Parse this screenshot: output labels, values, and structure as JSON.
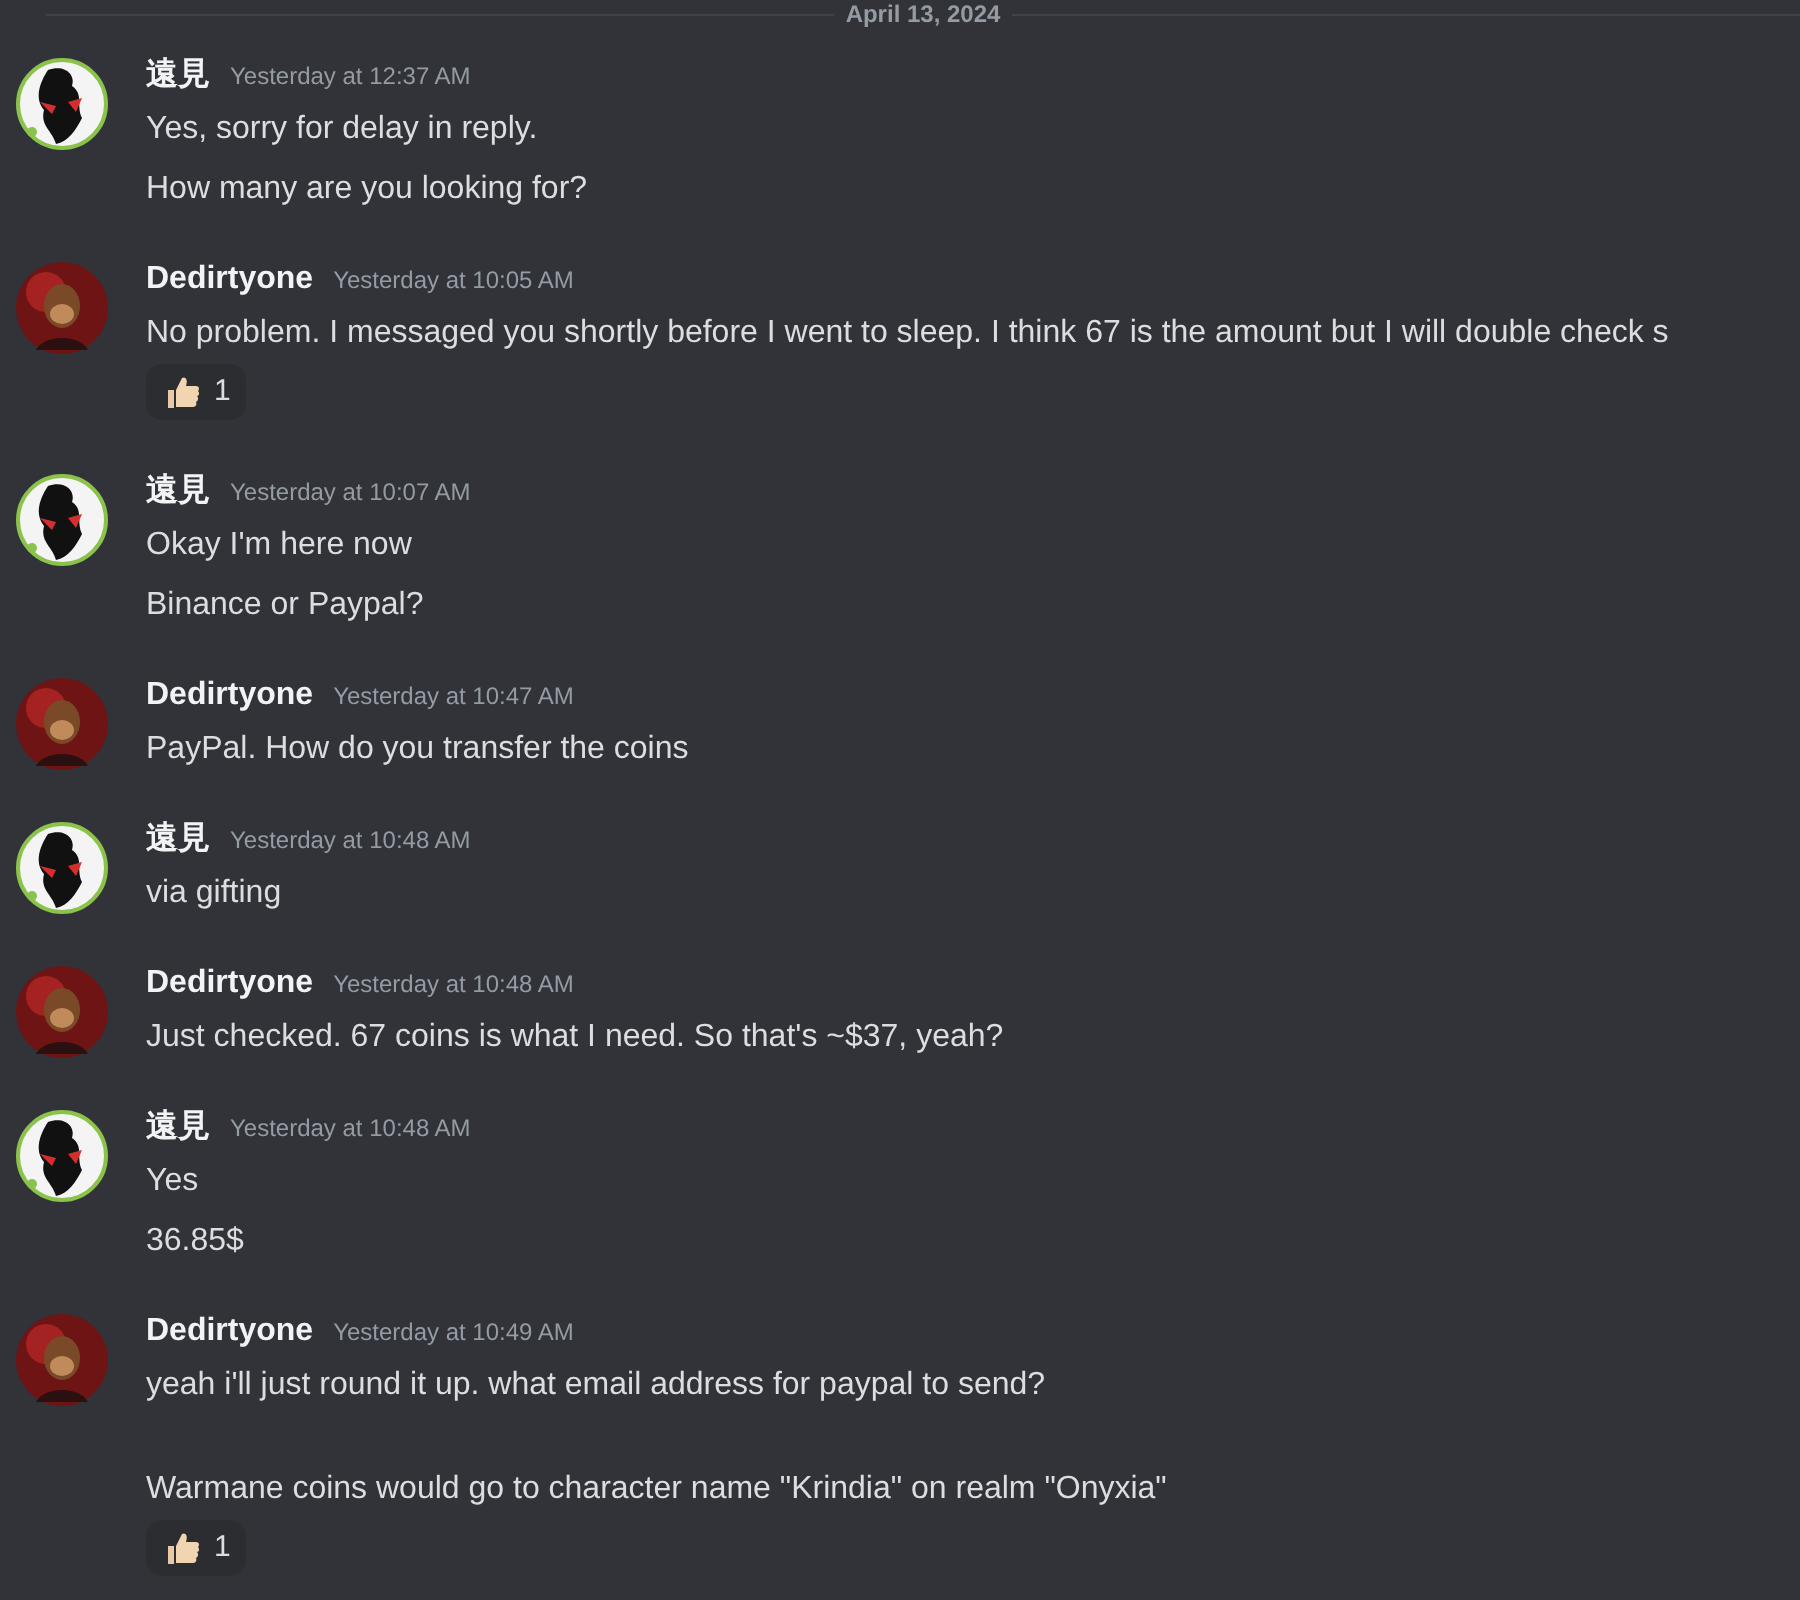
{
  "date_divider": "April 13, 2024",
  "messages": [
    {
      "author": "遠見",
      "kind": "ring",
      "time": "Yesterday at 12:37 AM",
      "lines": [
        "Yes, sorry for delay in reply.",
        "How many are you looking for?"
      ]
    },
    {
      "author": "Dedirtyone",
      "kind": "plain",
      "time": "Yesterday at 10:05 AM",
      "lines": [
        "No problem. I messaged you shortly before I went to sleep. I think 67 is the amount but I will double check s"
      ],
      "reactions": [
        {
          "count": "1"
        }
      ]
    },
    {
      "author": "遠見",
      "kind": "ring",
      "time": "Yesterday at 10:07 AM",
      "lines": [
        "Okay I'm here now",
        "Binance or Paypal?"
      ]
    },
    {
      "author": "Dedirtyone",
      "kind": "plain",
      "time": "Yesterday at 10:47 AM",
      "lines": [
        "PayPal. How do you transfer the coins"
      ]
    },
    {
      "author": "遠見",
      "kind": "ring",
      "time": "Yesterday at 10:48 AM",
      "lines": [
        "via gifting"
      ]
    },
    {
      "author": "Dedirtyone",
      "kind": "plain",
      "time": "Yesterday at 10:48 AM",
      "lines": [
        "Just checked. 67 coins is what I need. So that's ~$37, yeah?"
      ]
    },
    {
      "author": "遠見",
      "kind": "ring",
      "time": "Yesterday at 10:48 AM",
      "lines": [
        "Yes",
        "36.85$"
      ]
    },
    {
      "author": "Dedirtyone",
      "kind": "plain",
      "time": "Yesterday at 10:49 AM",
      "lines": [
        "yeah i'll just round it up. what email address for paypal to send?\n\nWarmane coins would go to character name \"Krindia\" on realm \"Onyxia\""
      ],
      "reactions": [
        {
          "count": "1"
        }
      ]
    }
  ]
}
